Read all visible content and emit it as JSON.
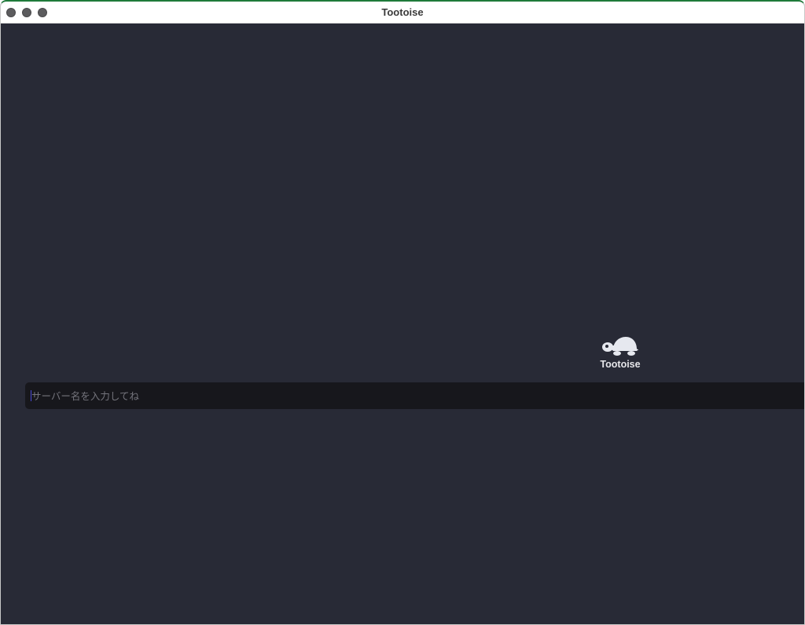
{
  "window": {
    "title": "Tootoise"
  },
  "logo": {
    "icon": "turtle-icon",
    "label": "Tootoise"
  },
  "server_input": {
    "value": "",
    "placeholder": "サーバー名を入力してね"
  },
  "colors": {
    "background": "#282a36",
    "input_background": "#17171c",
    "logo_fill": "#e6e8ef",
    "caret": "#4a4ad8"
  }
}
